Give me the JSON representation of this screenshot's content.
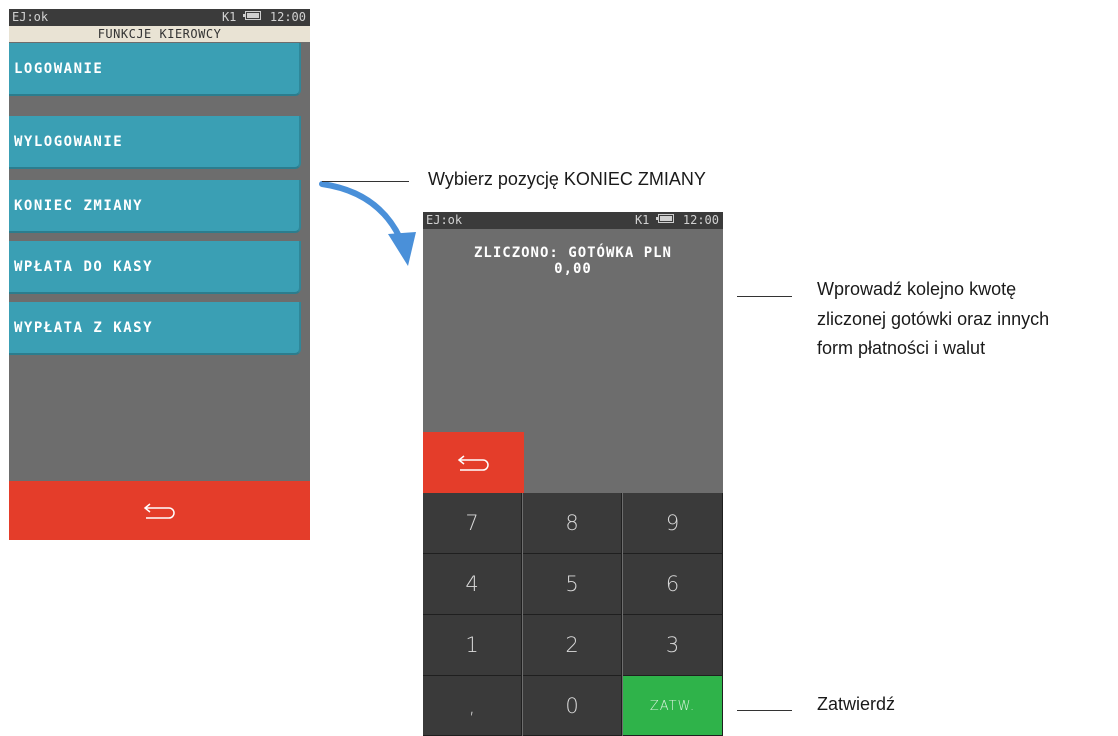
{
  "screen1": {
    "status_left": "EJ:ok",
    "status_right_k": "K1",
    "status_time": "12:00",
    "title": "FUNKCJE KIEROWCY",
    "menu": [
      "LOGOWANIE",
      "WYLOGOWANIE",
      "KONIEC ZMIANY",
      "WPŁATA DO KASY",
      "WYPŁATA Z KASY"
    ],
    "back_icon": "return-arrow-icon"
  },
  "screen2": {
    "status_left": "EJ:ok",
    "status_right_k": "K1",
    "status_time": "12:00",
    "display_line1": "ZLICZONO: GOTÓWKA PLN",
    "display_line2": "0,00",
    "keys": {
      "k7": "7",
      "k8": "8",
      "k9": "9",
      "k4": "4",
      "k5": "5",
      "k6": "6",
      "k1": "1",
      "k2": "2",
      "k3": "3",
      "kcomma": ",",
      "k0": "0",
      "kok": "ZATW."
    }
  },
  "callouts": {
    "select": "Wybierz pozycję KONIEC ZMIANY",
    "enter_line1": "Wprowadź kolejno kwotę",
    "enter_line2": "zliczonej gotówki oraz innych",
    "enter_line3": "form płatności i walut",
    "confirm": "Zatwierdź"
  },
  "colors": {
    "menu_teal": "#3a9fb4",
    "back_red": "#e43d2a",
    "ok_green": "#2fb34a",
    "arrow_blue": "#4a90d9"
  }
}
